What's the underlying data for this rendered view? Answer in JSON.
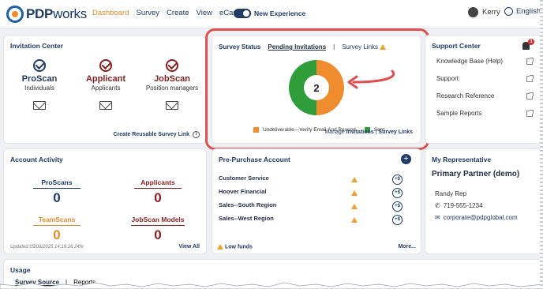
{
  "header": {
    "logo_bold": "PDP",
    "logo_rest": "works",
    "nav": [
      "Dashboard",
      "Survey",
      "Create",
      "View",
      "eCampus"
    ],
    "toggle_label": "New Experience",
    "user_name": "Kerry",
    "language": "English"
  },
  "invitation_center": {
    "title": "Invitation Center",
    "columns": [
      {
        "name": "ProScan",
        "sub": "Individuals",
        "color": "#1f3b66"
      },
      {
        "name": "Applicant",
        "sub": "Applicants",
        "color": "#8b1e1e"
      },
      {
        "name": "JobScan",
        "sub": "Position managers",
        "color": "#8b1e1e"
      }
    ],
    "reuse_link": "Create Reusable Survey Link"
  },
  "survey_status": {
    "title": "Survey Status",
    "tab_pending": "Pending Invitations",
    "separator": "|",
    "tab_links": "Survey Links",
    "center_value": "2",
    "legend_undeliverable": "Undeliverable—Verify Email And Resend",
    "legend_sent": "Sent",
    "manage_prefix": "Manage",
    "manage_invitations": "Invitations",
    "manage_sep": "|",
    "manage_links": "Survey Links",
    "highlight_color": "#e15050"
  },
  "chart_data": {
    "type": "pie",
    "categories": [
      "Undeliverable—Verify Email And Resend",
      "Sent"
    ],
    "values": [
      1,
      1
    ],
    "colors": [
      "#ef8c2e",
      "#2e9d3a"
    ],
    "center_label": "2"
  },
  "support_center": {
    "title": "Support Center",
    "badge": "1",
    "items": [
      "Knowledge Base (Help)",
      "Support",
      "Research Reference",
      "Sample Reports"
    ]
  },
  "account_activity": {
    "title": "Account Activity",
    "cells": [
      {
        "label": "ProScans",
        "value": "0",
        "color": "#1f3b66"
      },
      {
        "label": "Applicants",
        "value": "0",
        "color": "#8b1e1e"
      },
      {
        "label": "TeamScans",
        "value": "0",
        "color": "#e58a2a"
      },
      {
        "label": "JobScan Models",
        "value": "0",
        "color": "#8b1e1e"
      }
    ],
    "updated": "Updated 05/09/2025 14:19:26 24hr",
    "view_all": "View All"
  },
  "pre_purchase": {
    "title": "Pre-Purchase Account",
    "plus": "+",
    "rows": [
      "Customer Service",
      "Hoover Financial",
      "Sales--South Region",
      "Sales--West Region"
    ],
    "row_button": "+$",
    "low_funds": "Low funds",
    "more": "More..."
  },
  "representative": {
    "title": "My Representative",
    "partner": "Primary Partner (demo)",
    "name": "Randy Rep",
    "phone": "719-555-1234",
    "email": "corporate@pdpglobal.com"
  },
  "usage": {
    "title": "Usage",
    "tab_source": "Survey Source",
    "separator": "|",
    "tab_reports": "Reports"
  }
}
